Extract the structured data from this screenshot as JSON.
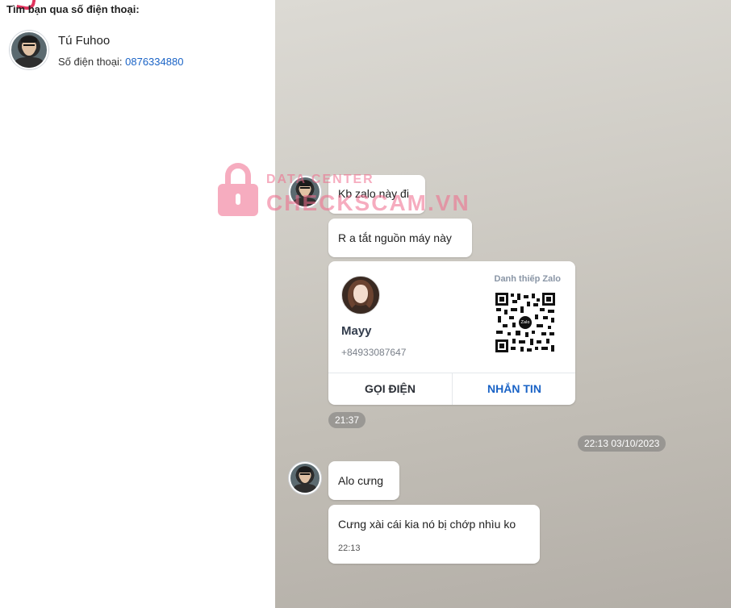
{
  "left_panel": {
    "heading": "Tìm bạn qua số điện thoại:",
    "contact": {
      "name": "Tú Fuhoo",
      "phone_label": "Số điện thoại: ",
      "phone_number": "0876334880"
    }
  },
  "chat": {
    "messages_group1": [
      {
        "text": "Kb zalo này đi"
      },
      {
        "text": "R a tắt nguồn máy này"
      }
    ],
    "card": {
      "label": "Danh thiếp Zalo",
      "name": "Mayy",
      "phone": "+84933087647",
      "qr_logo_text": "Zalo",
      "call_button": "GỌI ĐIỆN",
      "message_button": "NHẮN TIN"
    },
    "group1_time": "21:37",
    "date_separator": "22:13 03/10/2023",
    "messages_group2": [
      {
        "text": "Alo cưng"
      },
      {
        "text": "Cưng xài cái kia nó bị chớp nhìu ko",
        "time": "22:13"
      }
    ]
  },
  "watermark": {
    "line1": "DATA CENTER",
    "line2": "CHECKSCAM.VN"
  },
  "colors": {
    "link_blue": "#1a63c6",
    "watermark_pink": "#f06a8b"
  }
}
